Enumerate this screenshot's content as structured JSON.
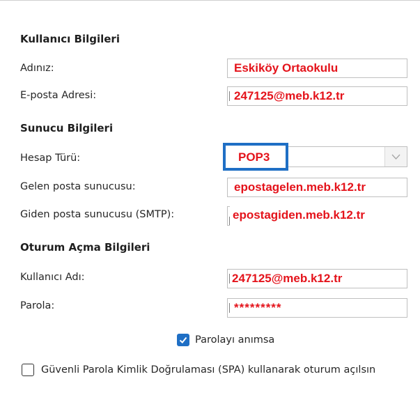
{
  "sections": {
    "user_info": "Kullanıcı Bilgileri",
    "server_info": "Sunucu Bilgileri",
    "logon_info": "Oturum Açma Bilgileri"
  },
  "fields": {
    "name": {
      "label": "Adınız:",
      "value": "Eskiköy Ortaokulu"
    },
    "email": {
      "label": "E-posta Adresi:",
      "value": "247125@meb.k12.tr"
    },
    "account_type": {
      "label": "Hesap Türü:",
      "value": "POP3",
      "icon": "chevron-down-icon"
    },
    "incoming_server": {
      "label": "Gelen posta sunucusu:",
      "value": "epostagelen.meb.k12.tr"
    },
    "outgoing_server": {
      "label": "Giden posta sunucusu (SMTP):",
      "value": "epostagiden.meb.k12.tr"
    },
    "username": {
      "label": "Kullanıcı Adı:",
      "value": "247125@meb.k12.tr"
    },
    "password": {
      "label": "Parola:",
      "value": "*********"
    }
  },
  "checkboxes": {
    "remember_password": {
      "label": "Parolayı anımsa",
      "checked": true
    },
    "spa": {
      "label": "Güvenli Parola Kimlik Doğrulaması (SPA) kullanarak oturum açılsın",
      "checked": false
    }
  },
  "colors": {
    "value_text": "#e4131b",
    "highlight_border": "#1f6fc5",
    "checkbox_checked": "#1f6fc5"
  }
}
